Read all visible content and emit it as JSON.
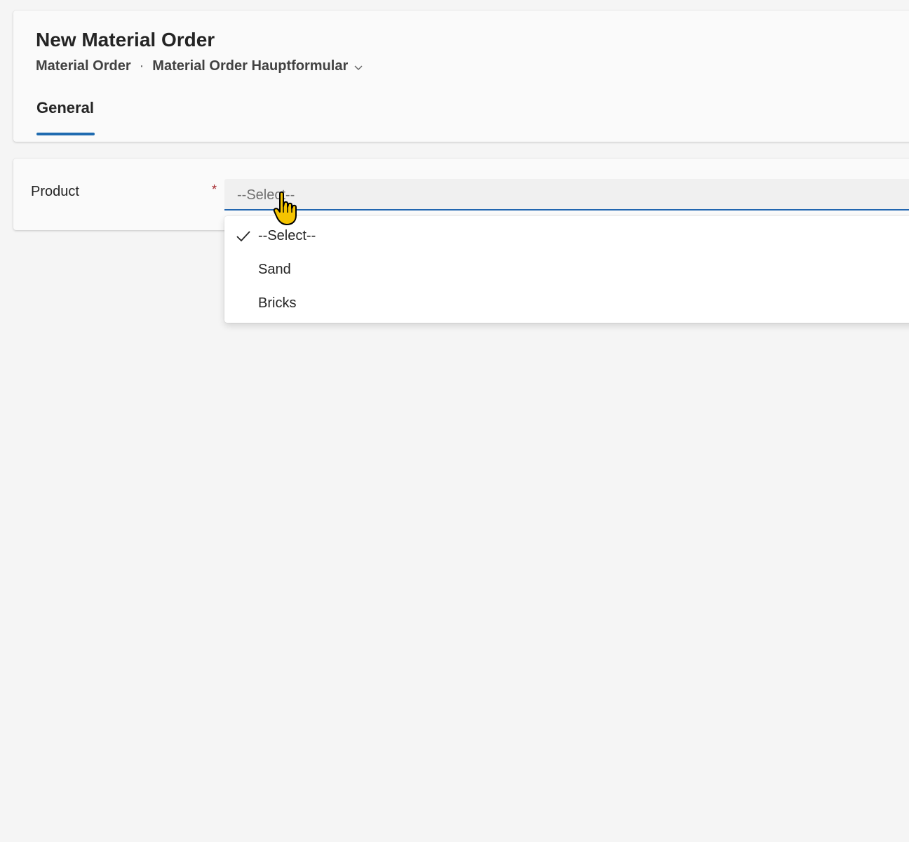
{
  "header": {
    "title": "New Material Order",
    "breadcrumb": {
      "entity": "Material Order",
      "separator": "·",
      "form": "Material Order Hauptformular"
    },
    "tabs": [
      {
        "label": "General",
        "active": true
      }
    ]
  },
  "form": {
    "product": {
      "label": "Product",
      "required_marker": "*",
      "value": "--Select--"
    }
  },
  "dropdown": {
    "options": [
      {
        "label": "--Select--",
        "selected": true
      },
      {
        "label": "Sand",
        "selected": false
      },
      {
        "label": "Bricks",
        "selected": false
      }
    ]
  },
  "icons": {
    "form_switcher": "chevron-down-icon",
    "selected_option": "checkmark-icon",
    "pointer": "hand-pointer-cursor-icon"
  },
  "colors": {
    "accent": "#1f6bb0",
    "required": "#a4262c",
    "cursor": "#f5c400"
  }
}
